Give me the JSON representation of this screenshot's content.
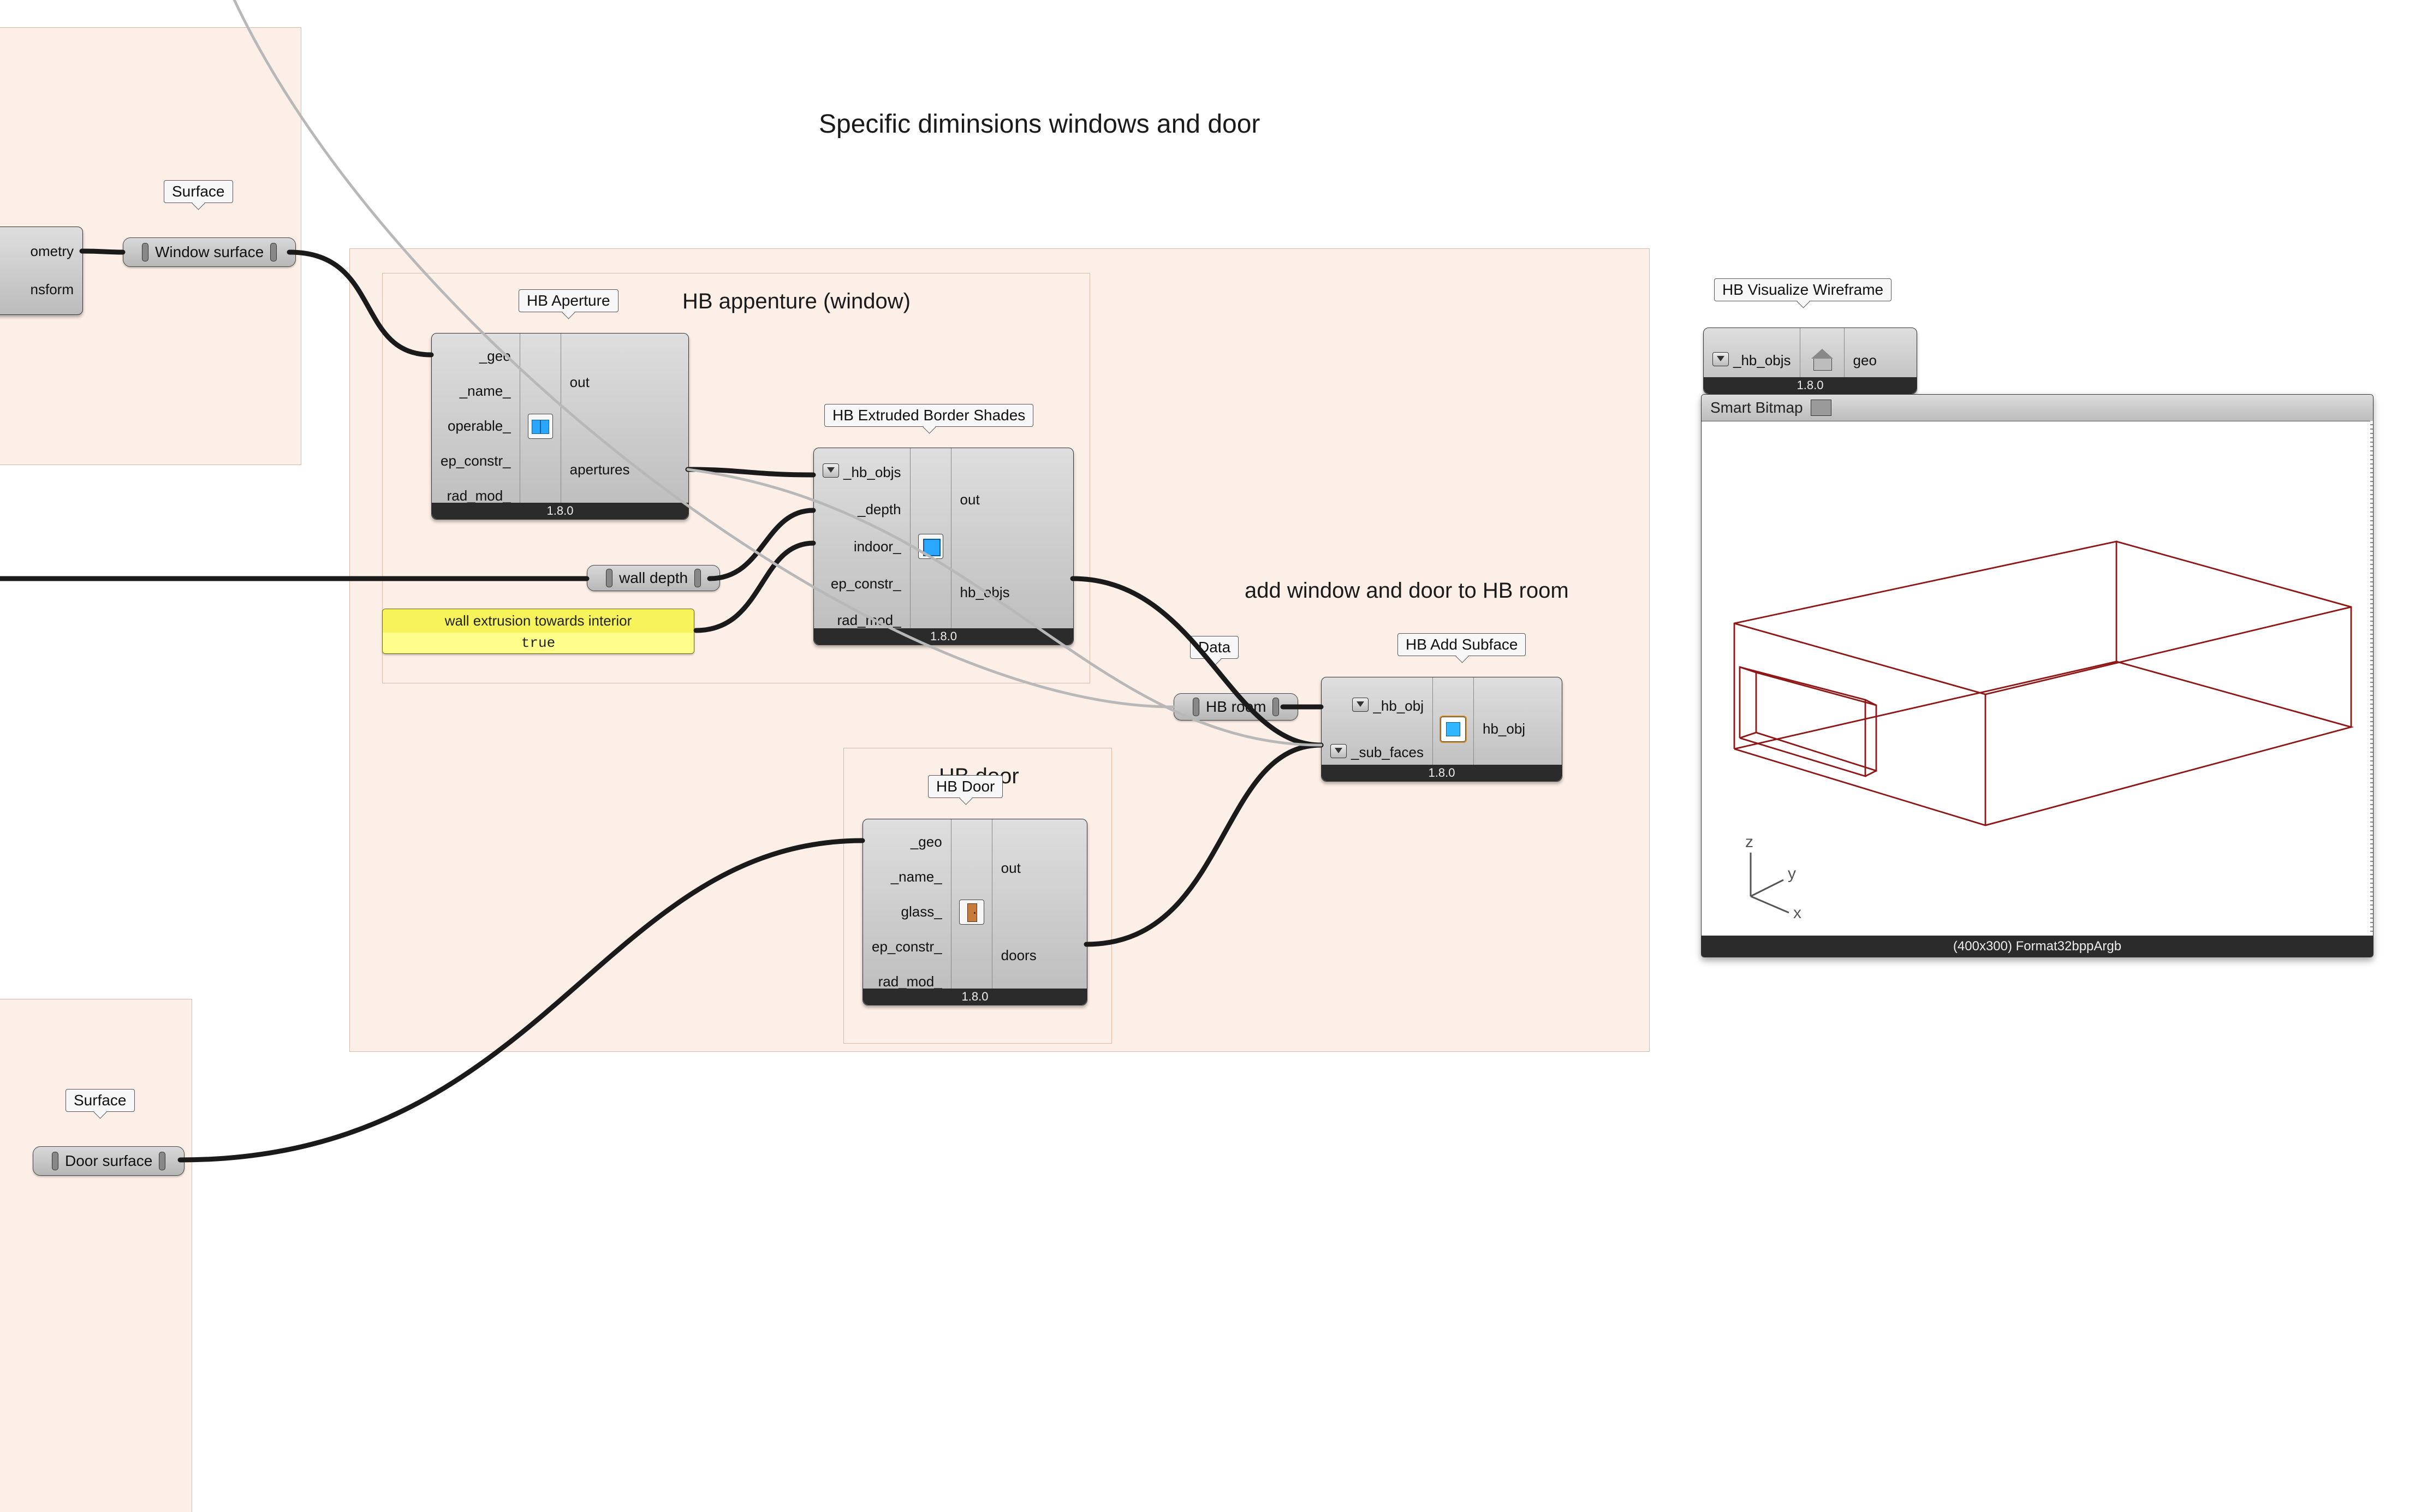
{
  "annotations": {
    "title": "Specific diminsions windows and door",
    "hb_appenture": "HB appenture (window)",
    "hb_door": "HB door",
    "add_subface": "add window and door to HB room"
  },
  "tags": {
    "surface_a": "Surface",
    "surface_b": "Surface",
    "hb_aperture": "HB Aperture",
    "hb_shades": "HB Extruded Border Shades",
    "hb_door": "HB Door",
    "data": "Data",
    "hb_addsub": "HB Add Subface",
    "hb_viswire": "HB Visualize Wireframe"
  },
  "params": {
    "window_surface": "Window surface",
    "door_surface": "Door surface",
    "wall_depth": "wall depth",
    "hb_room": "HB room",
    "geometry": "ometry",
    "transform": "nsform"
  },
  "bool_panel": {
    "label": "wall extrusion towards interior",
    "value": "true"
  },
  "components": {
    "aperture": {
      "inputs": [
        "_geo",
        "_name_",
        "operable_",
        "ep_constr_",
        "rad_mod_"
      ],
      "outputs": [
        "out",
        "apertures"
      ],
      "version": "1.8.0"
    },
    "shades": {
      "inputs": [
        "_hb_objs",
        "_depth",
        "indoor_",
        "ep_constr_",
        "rad_mod_"
      ],
      "outputs": [
        "out",
        "hb_objs"
      ],
      "version": "1.8.0"
    },
    "door": {
      "inputs": [
        "_geo",
        "_name_",
        "glass_",
        "ep_constr_",
        "rad_mod_"
      ],
      "outputs": [
        "out",
        "doors"
      ],
      "version": "1.8.0"
    },
    "addsub": {
      "inputs": [
        "_hb_obj",
        "_sub_faces"
      ],
      "outputs": [
        "hb_obj"
      ],
      "version": "1.8.0"
    },
    "viswire": {
      "inputs": [
        "_hb_objs"
      ],
      "outputs": [
        "geo"
      ],
      "version": "1.8.0"
    }
  },
  "viewer": {
    "title": "Smart Bitmap",
    "footer": "(400x300) Format32bppArgb",
    "axes": {
      "x": "x",
      "y": "y",
      "z": "z"
    }
  }
}
